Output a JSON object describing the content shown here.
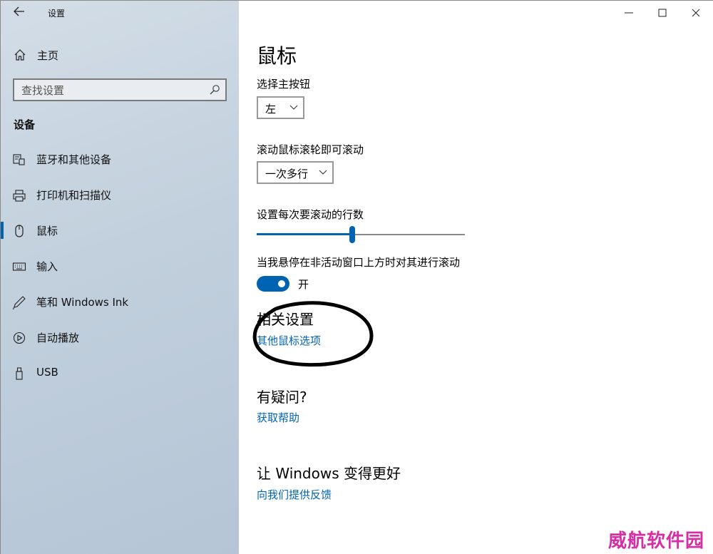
{
  "window": {
    "title": "设置",
    "controls": {
      "minimize": "minimize",
      "maximize": "maximize",
      "close": "close"
    }
  },
  "sidebar": {
    "home_label": "主页",
    "search_placeholder": "查找设置",
    "section_title": "设备",
    "items": [
      {
        "label": "蓝牙和其他设备",
        "icon": "bluetooth-devices-icon"
      },
      {
        "label": "打印机和扫描仪",
        "icon": "printer-icon"
      },
      {
        "label": "鼠标",
        "icon": "mouse-icon",
        "active": true
      },
      {
        "label": "输入",
        "icon": "keyboard-icon"
      },
      {
        "label": "笔和 Windows Ink",
        "icon": "pen-icon"
      },
      {
        "label": "自动播放",
        "icon": "autoplay-icon"
      },
      {
        "label": "USB",
        "icon": "usb-icon"
      }
    ]
  },
  "main": {
    "title": "鼠标",
    "primary_button": {
      "label": "选择主按钮",
      "value": "左"
    },
    "scroll_wheel": {
      "label": "滚动鼠标滚轮即可滚动",
      "value": "一次多行"
    },
    "lines_to_scroll": {
      "label": "设置每次要滚动的行数",
      "value_fraction": 0.46
    },
    "inactive_scroll": {
      "label": "当我悬停在非活动窗口上方时对其进行滚动",
      "state": "开",
      "on": true
    },
    "related": {
      "heading": "相关设置",
      "link": "其他鼠标选项"
    },
    "help": {
      "heading": "有疑问?",
      "link": "获取帮助"
    },
    "feedback": {
      "heading": "让 Windows 变得更好",
      "link": "向我们提供反馈"
    }
  },
  "watermark": "威航软件园",
  "colors": {
    "accent": "#0063b1",
    "sidebar": "#c2d0dd",
    "watermark": "#d62fa6",
    "annotation": "#000000"
  }
}
